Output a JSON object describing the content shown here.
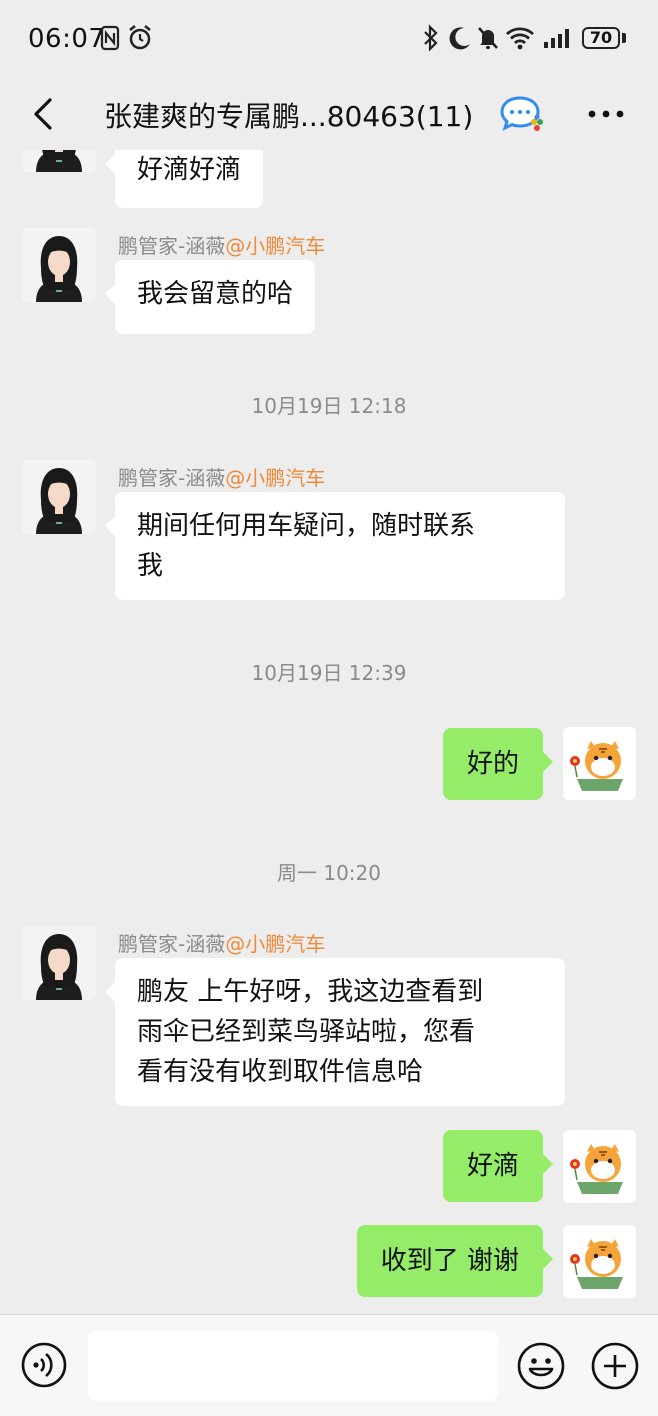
{
  "status_bar": {
    "time": "06:07",
    "battery": "70",
    "icons": [
      "nfc-icon",
      "alarm-icon",
      "bluetooth-icon",
      "moon-icon",
      "mute-icon",
      "wifi-icon",
      "signal-icon"
    ]
  },
  "header": {
    "title": "张建爽的专属鹏...80463(11)",
    "icons": [
      "back-arrow-icon",
      "group-chat-icon",
      "more-icon"
    ]
  },
  "messages": [
    {
      "side": "in",
      "text": "好滴好滴"
    },
    {
      "side": "in",
      "sender_name": "鹏管家-涵薇",
      "sender_org": "@小鹏汽车",
      "text": "我会留意的哈"
    },
    {
      "type": "time",
      "text": "10月19日 12:18"
    },
    {
      "side": "in",
      "sender_name": "鹏管家-涵薇",
      "sender_org": "@小鹏汽车",
      "text_lines": [
        "期间任何用车疑问，随时联系",
        "我"
      ]
    },
    {
      "type": "time",
      "text": "10月19日 12:39"
    },
    {
      "side": "out",
      "text": "好的"
    },
    {
      "type": "time",
      "text": "周一 10:20"
    },
    {
      "side": "in",
      "sender_name": "鹏管家-涵薇",
      "sender_org": "@小鹏汽车",
      "text_lines": [
        "鹏友 上午好呀，我这边查看到",
        "雨伞已经到菜鸟驿站啦，您看",
        "看有没有收到取件信息哈"
      ]
    },
    {
      "side": "out",
      "text": "好滴"
    },
    {
      "side": "out",
      "text": "收到了 谢谢"
    }
  ],
  "input_bar": {
    "placeholder": "",
    "icons": [
      "voice-icon",
      "emoji-icon",
      "plus-icon"
    ]
  },
  "colors": {
    "background": "#ededed",
    "incoming_bubble": "#ffffff",
    "outgoing_bubble": "#95ec69",
    "org_tag": "#f08a3a",
    "meta_text": "#8a8a8a"
  }
}
